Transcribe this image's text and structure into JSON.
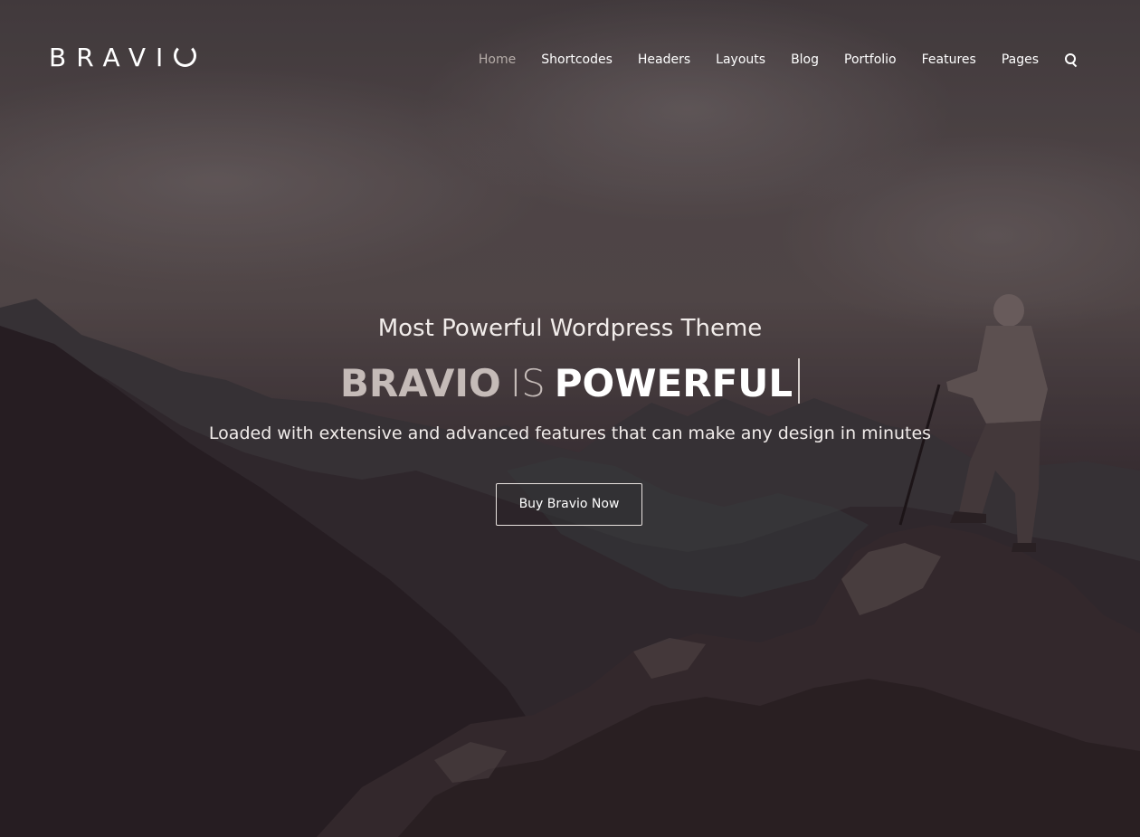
{
  "header": {
    "logo_text": "BRAVI",
    "nav_items": [
      {
        "label": "Home",
        "active": true
      },
      {
        "label": "Shortcodes"
      },
      {
        "label": "Headers"
      },
      {
        "label": "Layouts"
      },
      {
        "label": "Blog"
      },
      {
        "label": "Portfolio"
      },
      {
        "label": "Features"
      },
      {
        "label": "Pages"
      }
    ],
    "search_icon": "search-icon"
  },
  "hero": {
    "subtitle": "Most Powerful Wordpress Theme",
    "headline_brand": "BRAVIO",
    "headline_is": "IS",
    "headline_word": "POWERFUL",
    "tagline": "Loaded with extensive and advanced features that can make any design in minutes",
    "cta_label": "Buy Bravio Now"
  },
  "colors": {
    "nav_active": "#b6ada9",
    "text": "#ffffff",
    "headline_muted": "#c5bbb8"
  }
}
